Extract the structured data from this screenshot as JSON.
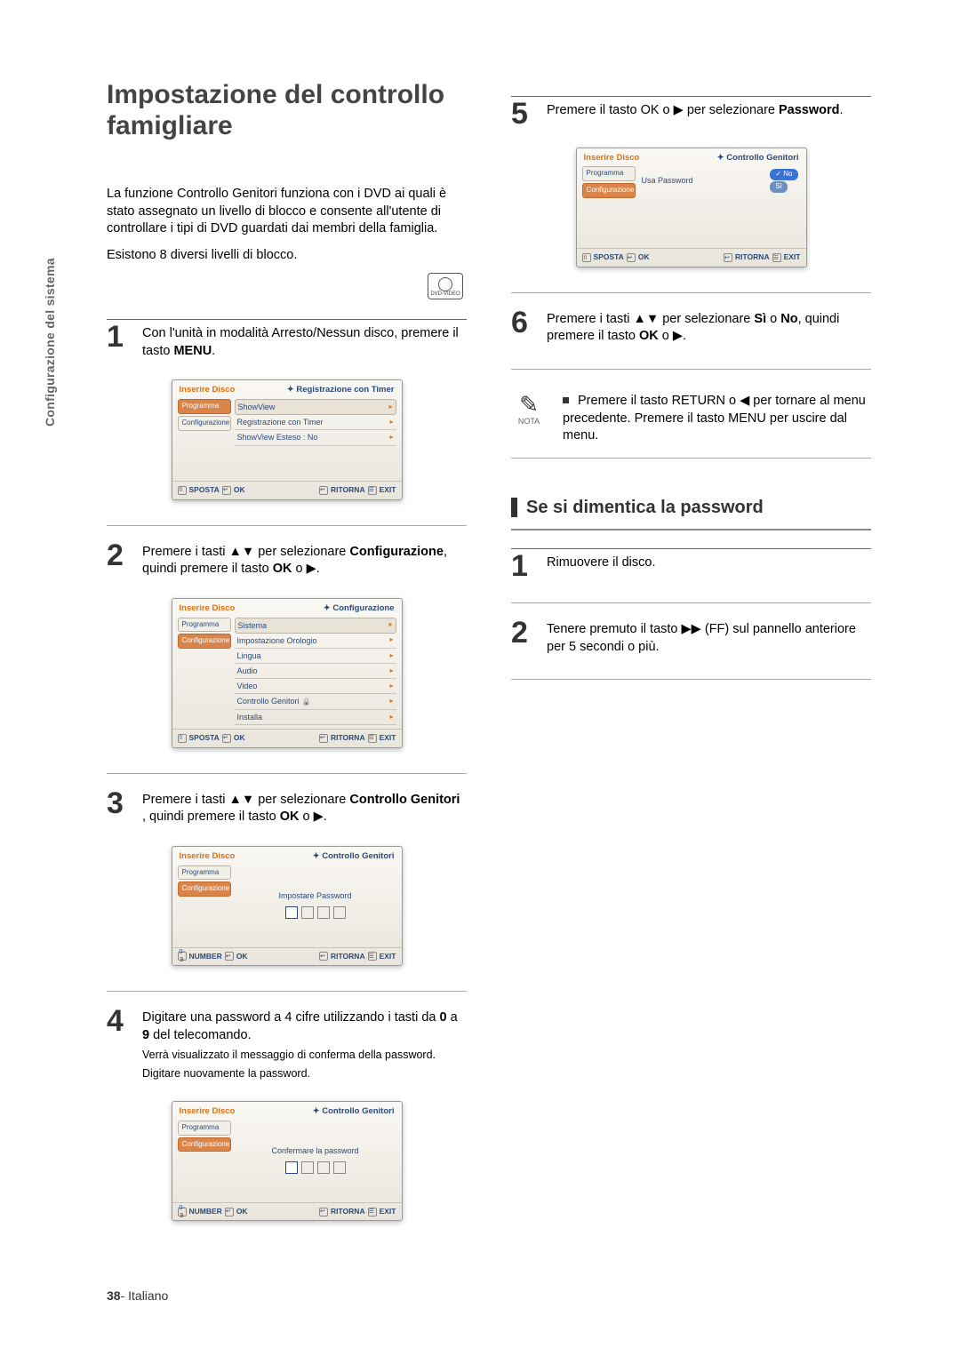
{
  "sidetab": "Configurazione del sistema",
  "title": "Impostazione del controllo famigliare",
  "intro1": "La funzione Controllo Genitori  funziona con i DVD ai quali è stato assegnato un livello di blocco e consente all'utente di controllare i tipi di DVD guardati dai membri della famiglia.",
  "intro2": "Esistono 8 diversi livelli di blocco.",
  "dvdlogo": "DVD-VIDEO",
  "steps_left": [
    {
      "n": "1",
      "txt": "Con l'unità in modalità Arresto/Nessun disco, premere il tasto ",
      "b": "MENU",
      "txt2": "."
    },
    {
      "n": "2",
      "txt": "Premere i tasti ▲▼ per selezionare ",
      "b": "Configurazione",
      "txt2": ", quindi premere il tasto ",
      "b2": "OK",
      "txt3": " o ",
      "sym": "▶",
      "txt4": "."
    },
    {
      "n": "3",
      "txt": "Premere i tasti ▲▼ per selezionare ",
      "b": "Controllo Genitori",
      "txt2": " , quindi premere il tasto ",
      "b2": "OK",
      "txt3": " o ",
      "sym": "▶",
      "txt4": "."
    },
    {
      "n": "4",
      "txt": "Digitare una password a 4 cifre utilizzando i tasti da ",
      "b": "0",
      "txt2": " a ",
      "b2": "9",
      "txt3": " del telecomando."
    }
  ],
  "step4_sub1": "Verrà visualizzato il messaggio di conferma della password.",
  "step4_sub2": "Digitare nuovamente la password.",
  "steps_right": [
    {
      "n": "5",
      "txt": "Premere il tasto OK o ",
      "sym": "▶",
      "txt2": " per selezionare ",
      "b": "Password",
      "txt3": "."
    },
    {
      "n": "6",
      "txt": "Premere i tasti  ▲▼ per selezionare ",
      "b": "Sì",
      "txt2": " o ",
      "b2": "No",
      "txt3": ", quindi premere il tasto ",
      "b3": "OK",
      "txt4": " o ",
      "sym": "▶",
      "txt5": "."
    }
  ],
  "note_label": "NOTA",
  "note_text": "Premere il tasto RETURN o ◀ per tornare al menu precedente. Premere il tasto MENU per uscire dal menu.",
  "h2": "Se si dimentica la password",
  "forgot": [
    {
      "n": "1",
      "txt": "Rimuovere il disco."
    },
    {
      "n": "2",
      "txt": "Tenere premuto il tasto ",
      "sym": "▶▶",
      "txt2": " (FF) sul pannello anteriore per 5 secondi o più."
    }
  ],
  "osd_common": {
    "disc": "Inserire Disco",
    "prog": "Programma",
    "conf": "Configurazione",
    "sposta": "SPOSTA",
    "ok": "OK",
    "ritorna": "RITORNA",
    "exit": "EXIT",
    "number": "NUMBER"
  },
  "osd1": {
    "title": "Registrazione con Timer",
    "items": [
      "ShowView",
      "Registrazione con Timer",
      "ShowView Esteso : No"
    ]
  },
  "osd2": {
    "title": "Configurazione",
    "items": [
      "Sistema",
      "Impostazione Orologio",
      "Lingua",
      "Audio",
      "Video",
      "Controllo Genitori",
      "Installa"
    ],
    "lockIndex": 5
  },
  "osd3": {
    "title": "Controllo Genitori",
    "label": "Impostare Password"
  },
  "osd4": {
    "title": "Controllo Genitori",
    "label": "Confermare la password"
  },
  "osd5": {
    "title": "Controllo Genitori",
    "rowlabel": "Usa Password",
    "no": "No",
    "si": "Sì"
  },
  "pagenum": "38",
  "pagelabel": "- Italiano"
}
